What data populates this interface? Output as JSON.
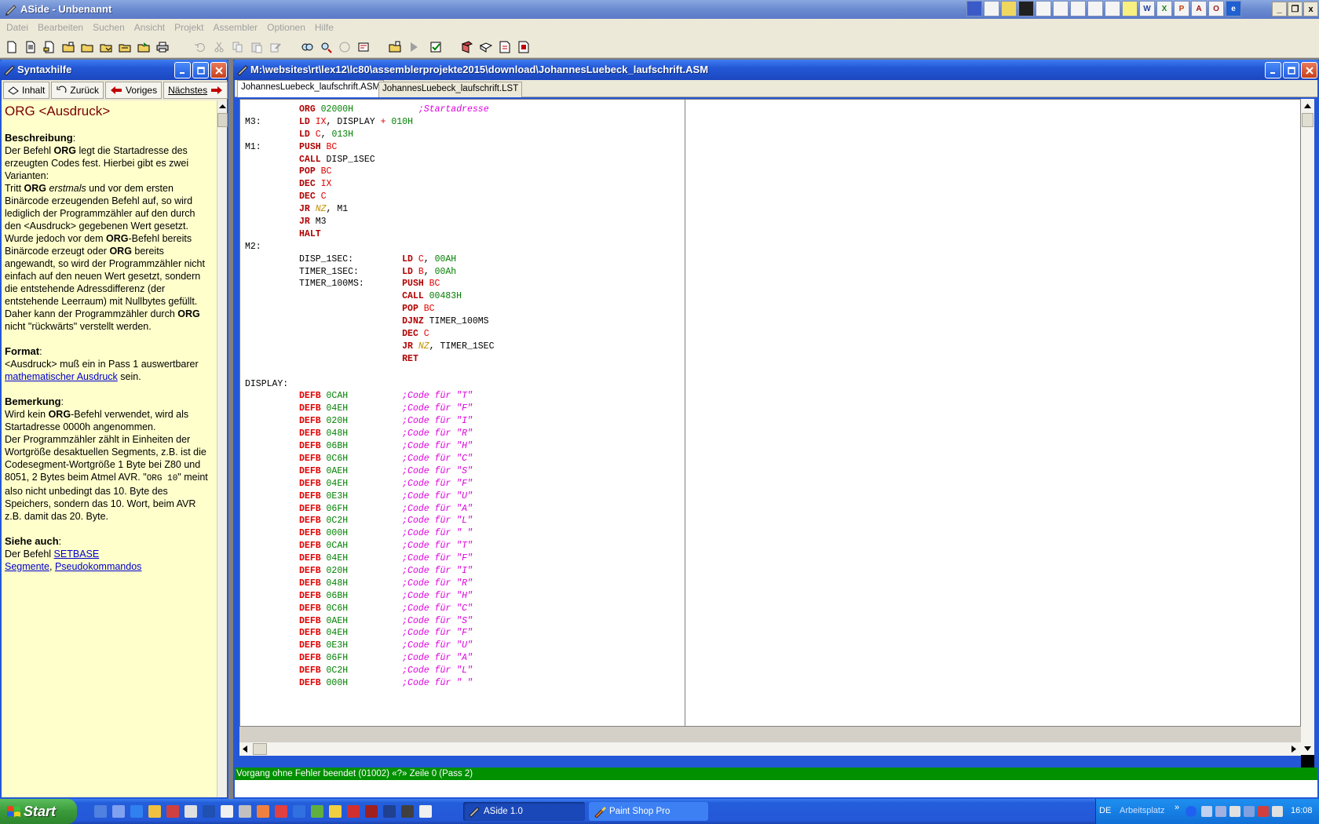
{
  "app": {
    "title": "ASide - Unbenannt",
    "minimize": "_",
    "restore": "❐",
    "close": "x"
  },
  "menu": [
    "Datei",
    "Bearbeiten",
    "Suchen",
    "Ansicht",
    "Projekt",
    "Assembler",
    "Optionen",
    "Hilfe"
  ],
  "help_window": {
    "title": "Syntaxhilfe",
    "nav": {
      "contents": "Inhalt",
      "back": "Zurück",
      "previous": "Voriges",
      "next": "Nächstes"
    },
    "heading": "ORG <Ausdruck>",
    "beschreibung_label": "Beschreibung",
    "beschreibung_1": "Der Befehl",
    "org": "ORG",
    "beschreibung_2": "legt die Startadresse des erzeugten Codes fest. Hierbei gibt es zwei Varianten:",
    "tritt": "Tritt",
    "erstmals": "erstmals",
    "varianten_1": "und vor dem ersten Binärcode erzeugenden Befehl auf, so wird lediglich der Programmzähler auf den durch den <Ausdruck> gegebenen Wert gesetzt.",
    "wurde_1": "Wurde jedoch vor dem",
    "wurde_2": "-Befehl bereits Binärcode erzeugt oder",
    "wurde_3": "bereits angewandt, so wird der Programmzähler nicht einfach auf den neuen Wert gesetzt, sondern die entstehende Adressdifferenz (der entstehende Leerraum) mit Nullbytes gefüllt. Daher kann der Programmzähler durch",
    "wurde_4": "nicht \"rückwärts\" verstellt werden.",
    "format_label": "Format",
    "format_text_1": "<Ausdruck> muß ein in Pass 1 auswertbarer",
    "format_link": "mathematischer Ausdruck",
    "format_text_2": "sein.",
    "bemerkung_label": "Bemerkung",
    "bemerkung_1": "Wird kein",
    "bemerkung_2": "-Befehl verwendet, wird als Startadresse 0000h angenommen.",
    "bemerkung_3": "Der Programmzähler zählt in Einheiten der Wortgröße desaktuellen Segments, z.B. ist die Codesegment-Wortgröße 1 Byte bei Z80 und 8051, 2 Bytes beim Atmel AVR. \"",
    "bemerkung_code": "ORG 10",
    "bemerkung_4": "\" meint also nicht unbedingt das 10. Byte des Speichers, sondern das 10. Wort, beim AVR z.B. damit das 20. Byte.",
    "siehe_label": "Siehe auch",
    "siehe_1": "Der Befehl",
    "siehe_link_setbase": "SETBASE",
    "siehe_link_segmente": "Segmente",
    "siehe_link_pseudo": "Pseudokommandos"
  },
  "editor": {
    "title": "M:\\websites\\rt\\lex12\\lc80\\assemblerprojekte2015\\download\\JohannesLuebeck_laufschrift.ASM",
    "tabs": [
      "JohannesLuebeck_laufschrift.ASM",
      "JohannesLuebeck_laufschrift.LST"
    ],
    "status": "Vorgang ohne Fehler beendet (01002) «?» Zeile 0 (Pass 2)"
  },
  "code": [
    [
      [
        "",
        "          "
      ],
      [
        "kw",
        "ORG"
      ],
      [
        "",
        " "
      ],
      [
        "num",
        "02000H"
      ],
      [
        "",
        "            "
      ],
      [
        "cmt",
        ";Startadresse"
      ]
    ],
    [
      [
        "",
        "M3:       "
      ],
      [
        "kw",
        "LD"
      ],
      [
        "",
        " "
      ],
      [
        "reg",
        "IX"
      ],
      [
        "",
        ", DISPLAY "
      ],
      [
        "op",
        "+"
      ],
      [
        "",
        " "
      ],
      [
        "num",
        "010H"
      ]
    ],
    [
      [
        "",
        "          "
      ],
      [
        "kw",
        "LD"
      ],
      [
        "",
        " "
      ],
      [
        "reg",
        "C"
      ],
      [
        "",
        ", "
      ],
      [
        "num",
        "013H"
      ]
    ],
    [
      [
        "",
        "M1:       "
      ],
      [
        "kw",
        "PUSH"
      ],
      [
        "",
        " "
      ],
      [
        "reg",
        "BC"
      ]
    ],
    [
      [
        "",
        "          "
      ],
      [
        "kw",
        "CALL"
      ],
      [
        "",
        " DISP_1SEC"
      ]
    ],
    [
      [
        "",
        "          "
      ],
      [
        "kw",
        "POP"
      ],
      [
        "",
        " "
      ],
      [
        "reg",
        "BC"
      ]
    ],
    [
      [
        "",
        "          "
      ],
      [
        "kw",
        "DEC"
      ],
      [
        "",
        " "
      ],
      [
        "reg",
        "IX"
      ]
    ],
    [
      [
        "",
        "          "
      ],
      [
        "kw",
        "DEC"
      ],
      [
        "",
        " "
      ],
      [
        "reg",
        "C"
      ]
    ],
    [
      [
        "",
        "          "
      ],
      [
        "kw",
        "JR"
      ],
      [
        "",
        " "
      ],
      [
        "cond",
        "NZ"
      ],
      [
        "",
        ", M1"
      ]
    ],
    [
      [
        "",
        "          "
      ],
      [
        "kw",
        "JR"
      ],
      [
        "",
        " M3"
      ]
    ],
    [
      [
        "",
        "          "
      ],
      [
        "kw",
        "HALT"
      ]
    ],
    [
      [
        "",
        "M2:"
      ]
    ],
    [
      [
        "",
        "          DISP_1SEC:         "
      ],
      [
        "kw",
        "LD"
      ],
      [
        "",
        " "
      ],
      [
        "reg",
        "C"
      ],
      [
        "",
        ", "
      ],
      [
        "num",
        "00AH"
      ]
    ],
    [
      [
        "",
        "          TIMER_1SEC:        "
      ],
      [
        "kw",
        "LD"
      ],
      [
        "",
        " "
      ],
      [
        "reg",
        "B"
      ],
      [
        "",
        ", "
      ],
      [
        "num",
        "00Ah"
      ]
    ],
    [
      [
        "",
        "          TIMER_100MS:       "
      ],
      [
        "kw",
        "PUSH"
      ],
      [
        "",
        " "
      ],
      [
        "reg",
        "BC"
      ]
    ],
    [
      [
        "",
        "                             "
      ],
      [
        "kw",
        "CALL"
      ],
      [
        "",
        " "
      ],
      [
        "num",
        "00483H"
      ]
    ],
    [
      [
        "",
        "                             "
      ],
      [
        "kw",
        "POP"
      ],
      [
        "",
        " "
      ],
      [
        "reg",
        "BC"
      ]
    ],
    [
      [
        "",
        "                             "
      ],
      [
        "kw",
        "DJNZ"
      ],
      [
        "",
        " TIMER_100MS"
      ]
    ],
    [
      [
        "",
        "                             "
      ],
      [
        "kw",
        "DEC"
      ],
      [
        "",
        " "
      ],
      [
        "reg",
        "C"
      ]
    ],
    [
      [
        "",
        "                             "
      ],
      [
        "kw",
        "JR"
      ],
      [
        "",
        " "
      ],
      [
        "cond",
        "NZ"
      ],
      [
        "",
        ", TIMER_1SEC"
      ]
    ],
    [
      [
        "",
        "                             "
      ],
      [
        "kw",
        "RET"
      ]
    ],
    [
      [
        "",
        ""
      ]
    ],
    [
      [
        "",
        "DISPLAY:"
      ]
    ],
    [
      [
        "",
        "          "
      ],
      [
        "df",
        "DEFB"
      ],
      [
        "",
        " "
      ],
      [
        "num",
        "0CAH"
      ],
      [
        "",
        "          "
      ],
      [
        "cmt",
        ";Code für \"T\""
      ]
    ],
    [
      [
        "",
        "          "
      ],
      [
        "df",
        "DEFB"
      ],
      [
        "",
        " "
      ],
      [
        "num",
        "04EH"
      ],
      [
        "",
        "          "
      ],
      [
        "cmt",
        ";Code für \"F\""
      ]
    ],
    [
      [
        "",
        "          "
      ],
      [
        "df",
        "DEFB"
      ],
      [
        "",
        " "
      ],
      [
        "num",
        "020H"
      ],
      [
        "",
        "          "
      ],
      [
        "cmt",
        ";Code für \"I\""
      ]
    ],
    [
      [
        "",
        "          "
      ],
      [
        "df",
        "DEFB"
      ],
      [
        "",
        " "
      ],
      [
        "num",
        "048H"
      ],
      [
        "",
        "          "
      ],
      [
        "cmt",
        ";Code für \"R\""
      ]
    ],
    [
      [
        "",
        "          "
      ],
      [
        "df",
        "DEFB"
      ],
      [
        "",
        " "
      ],
      [
        "num",
        "06BH"
      ],
      [
        "",
        "          "
      ],
      [
        "cmt",
        ";Code für \"H\""
      ]
    ],
    [
      [
        "",
        "          "
      ],
      [
        "df",
        "DEFB"
      ],
      [
        "",
        " "
      ],
      [
        "num",
        "0C6H"
      ],
      [
        "",
        "          "
      ],
      [
        "cmt",
        ";Code für \"C\""
      ]
    ],
    [
      [
        "",
        "          "
      ],
      [
        "df",
        "DEFB"
      ],
      [
        "",
        " "
      ],
      [
        "num",
        "0AEH"
      ],
      [
        "",
        "          "
      ],
      [
        "cmt",
        ";Code für \"S\""
      ]
    ],
    [
      [
        "",
        "          "
      ],
      [
        "df",
        "DEFB"
      ],
      [
        "",
        " "
      ],
      [
        "num",
        "04EH"
      ],
      [
        "",
        "          "
      ],
      [
        "cmt",
        ";Code für \"F\""
      ]
    ],
    [
      [
        "",
        "          "
      ],
      [
        "df",
        "DEFB"
      ],
      [
        "",
        " "
      ],
      [
        "num",
        "0E3H"
      ],
      [
        "",
        "          "
      ],
      [
        "cmt",
        ";Code für \"U\""
      ]
    ],
    [
      [
        "",
        "          "
      ],
      [
        "df",
        "DEFB"
      ],
      [
        "",
        " "
      ],
      [
        "num",
        "06FH"
      ],
      [
        "",
        "          "
      ],
      [
        "cmt",
        ";Code für \"A\""
      ]
    ],
    [
      [
        "",
        "          "
      ],
      [
        "df",
        "DEFB"
      ],
      [
        "",
        " "
      ],
      [
        "num",
        "0C2H"
      ],
      [
        "",
        "          "
      ],
      [
        "cmt",
        ";Code für \"L\""
      ]
    ],
    [
      [
        "",
        "          "
      ],
      [
        "df",
        "DEFB"
      ],
      [
        "",
        " "
      ],
      [
        "num",
        "000H"
      ],
      [
        "",
        "          "
      ],
      [
        "cmt",
        ";Code für \" \""
      ]
    ],
    [
      [
        "",
        "          "
      ],
      [
        "df",
        "DEFB"
      ],
      [
        "",
        " "
      ],
      [
        "num",
        "0CAH"
      ],
      [
        "",
        "          "
      ],
      [
        "cmt",
        ";Code für \"T\""
      ]
    ],
    [
      [
        "",
        "          "
      ],
      [
        "df",
        "DEFB"
      ],
      [
        "",
        " "
      ],
      [
        "num",
        "04EH"
      ],
      [
        "",
        "          "
      ],
      [
        "cmt",
        ";Code für \"F\""
      ]
    ],
    [
      [
        "",
        "          "
      ],
      [
        "df",
        "DEFB"
      ],
      [
        "",
        " "
      ],
      [
        "num",
        "020H"
      ],
      [
        "",
        "          "
      ],
      [
        "cmt",
        ";Code für \"I\""
      ]
    ],
    [
      [
        "",
        "          "
      ],
      [
        "df",
        "DEFB"
      ],
      [
        "",
        " "
      ],
      [
        "num",
        "048H"
      ],
      [
        "",
        "          "
      ],
      [
        "cmt",
        ";Code für \"R\""
      ]
    ],
    [
      [
        "",
        "          "
      ],
      [
        "df",
        "DEFB"
      ],
      [
        "",
        " "
      ],
      [
        "num",
        "06BH"
      ],
      [
        "",
        "          "
      ],
      [
        "cmt",
        ";Code für \"H\""
      ]
    ],
    [
      [
        "",
        "          "
      ],
      [
        "df",
        "DEFB"
      ],
      [
        "",
        " "
      ],
      [
        "num",
        "0C6H"
      ],
      [
        "",
        "          "
      ],
      [
        "cmt",
        ";Code für \"C\""
      ]
    ],
    [
      [
        "",
        "          "
      ],
      [
        "df",
        "DEFB"
      ],
      [
        "",
        " "
      ],
      [
        "num",
        "0AEH"
      ],
      [
        "",
        "          "
      ],
      [
        "cmt",
        ";Code für \"S\""
      ]
    ],
    [
      [
        "",
        "          "
      ],
      [
        "df",
        "DEFB"
      ],
      [
        "",
        " "
      ],
      [
        "num",
        "04EH"
      ],
      [
        "",
        "          "
      ],
      [
        "cmt",
        ";Code für \"F\""
      ]
    ],
    [
      [
        "",
        "          "
      ],
      [
        "df",
        "DEFB"
      ],
      [
        "",
        " "
      ],
      [
        "num",
        "0E3H"
      ],
      [
        "",
        "          "
      ],
      [
        "cmt",
        ";Code für \"U\""
      ]
    ],
    [
      [
        "",
        "          "
      ],
      [
        "df",
        "DEFB"
      ],
      [
        "",
        " "
      ],
      [
        "num",
        "06FH"
      ],
      [
        "",
        "          "
      ],
      [
        "cmt",
        ";Code für \"A\""
      ]
    ],
    [
      [
        "",
        "          "
      ],
      [
        "df",
        "DEFB"
      ],
      [
        "",
        " "
      ],
      [
        "num",
        "0C2H"
      ],
      [
        "",
        "          "
      ],
      [
        "cmt",
        ";Code für \"L\""
      ]
    ],
    [
      [
        "",
        "          "
      ],
      [
        "df",
        "DEFB"
      ],
      [
        "",
        " "
      ],
      [
        "num",
        "000H"
      ],
      [
        "",
        "          "
      ],
      [
        "cmt",
        ";Code für \" \""
      ]
    ]
  ],
  "taskbar": {
    "start": "Start",
    "tasks": [
      "ASide 1.0",
      "Paint Shop Pro"
    ],
    "lang": "DE",
    "address_toolbar": "Arbeitsplatz",
    "clock": "16:08"
  },
  "colors": {
    "status_green": "#009000",
    "help_bg": "#ffffcc",
    "title_blue": "#2457d6"
  },
  "icons": {
    "toolbar": [
      "new-file-icon",
      "new-doc-icon",
      "open-icon",
      "open-project-icon",
      "save-icon",
      "save-all-icon",
      "close-icon",
      "export-icon",
      "print-icon",
      "undo-icon",
      "cut-icon",
      "copy-icon",
      "paste-icon",
      "edit-icon",
      "find-icon",
      "replace-icon",
      "find-next-icon",
      "goto-icon",
      "project-icon",
      "run-icon",
      "check-icon",
      "book-icon",
      "book-open-icon",
      "help-icon",
      "help-red-icon"
    ]
  }
}
